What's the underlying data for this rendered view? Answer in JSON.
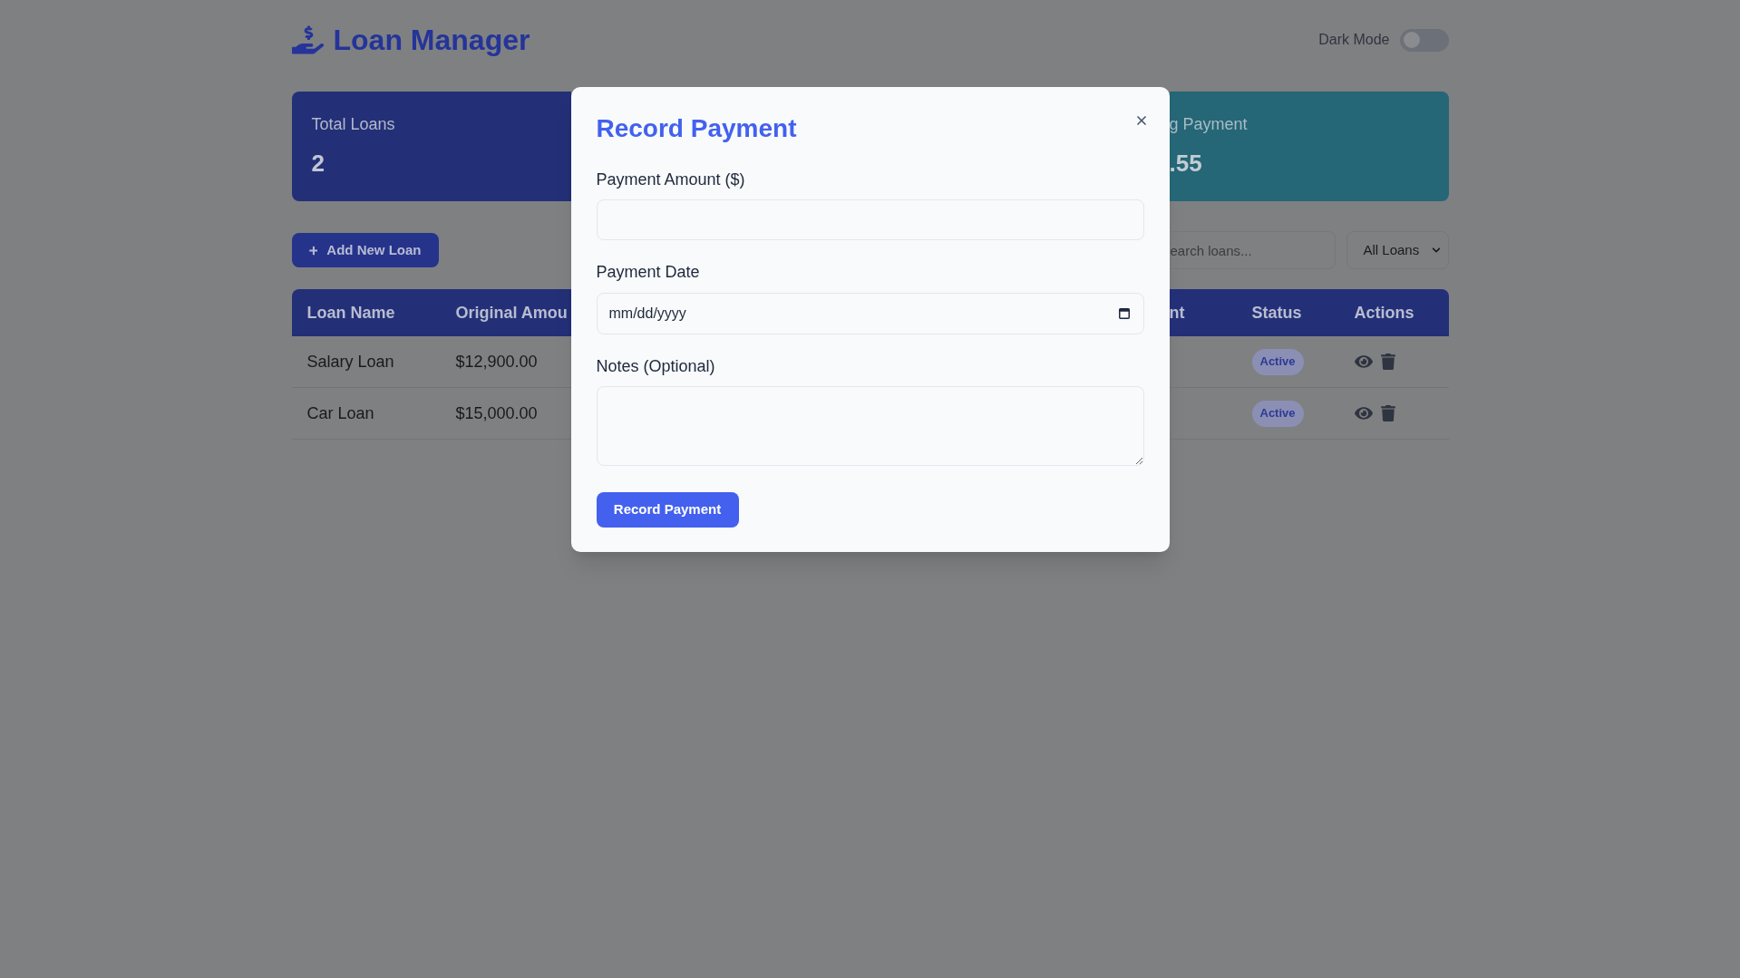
{
  "header": {
    "title": "Loan Manager",
    "dark_mode": {
      "label": "Dark Mode",
      "on": false
    }
  },
  "stats": [
    {
      "label": "Total Loans",
      "value": "2",
      "color": "#233077"
    },
    {
      "label": "g Payment",
      "value": ".55",
      "color": "#256677"
    }
  ],
  "toolbar": {
    "add_button": "Add New Loan",
    "search": {
      "placeholder": "earch loans..."
    },
    "filter": {
      "value": "All Loans"
    }
  },
  "table": {
    "columns": [
      "Loan Name",
      "Original Amou",
      "nt",
      "Status",
      "Actions"
    ],
    "rows": [
      {
        "loan_name": "Salary Loan",
        "original_amount": "$12,900.00",
        "status": "Active"
      },
      {
        "loan_name": "Car Loan",
        "original_amount": "$15,000.00",
        "status": "Active"
      }
    ]
  },
  "modal": {
    "title": "Record Payment",
    "fields": [
      {
        "kind": "number",
        "label": "Payment Amount ($)"
      },
      {
        "kind": "date",
        "label": "Payment Date",
        "placeholder": "mm/dd/yyyy"
      },
      {
        "kind": "textarea",
        "label": "Notes (Optional)"
      }
    ],
    "submit": "Record Payment"
  }
}
